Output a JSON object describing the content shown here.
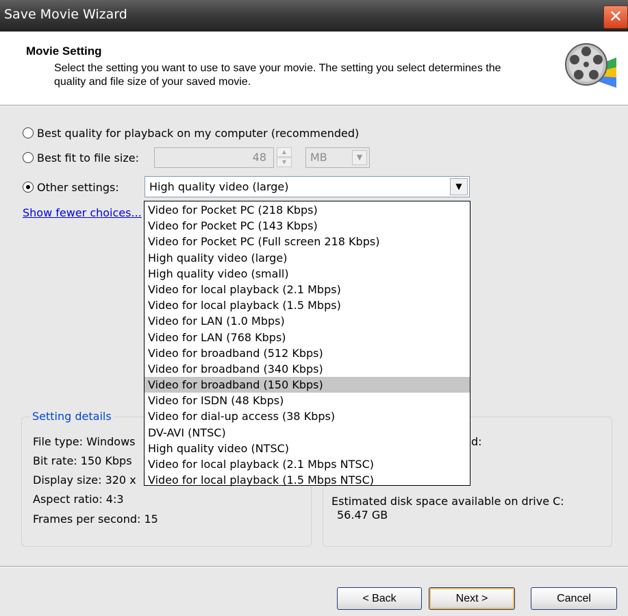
{
  "window": {
    "title": "Save Movie Wizard",
    "close_symbol": "✕",
    "icon": "film-reel-icon"
  },
  "header": {
    "title": "Movie Setting",
    "description": "Select the setting you want to use to save your movie. The setting you select determines the quality and file size of your saved movie."
  },
  "options": {
    "best_quality_label": "Best quality for playback on my computer (recommended)",
    "best_fit_label": "Best fit to file size:",
    "best_fit_value": "48",
    "best_fit_unit": "MB",
    "other_settings_label": "Other settings:",
    "selected_setting": "High quality video (large)",
    "selected_option": "other_settings"
  },
  "show_fewer_link": "Show fewer choices...",
  "dropdown": {
    "items": [
      "Video for Pocket PC (218 Kbps)",
      "Video for Pocket PC (143 Kbps)",
      "Video for Pocket PC (Full screen 218 Kbps)",
      "High quality video (large)",
      "High quality video (small)",
      "Video for local playback (2.1 Mbps)",
      "Video for local playback (1.5 Mbps)",
      "Video for LAN (1.0 Mbps)",
      "Video for LAN (768 Kbps)",
      "Video for broadband (512 Kbps)",
      "Video for broadband (340 Kbps)",
      "Video for broadband (150 Kbps)",
      "Video for ISDN (48 Kbps)",
      "Video for dial-up access (38 Kbps)",
      "DV-AVI (NTSC)",
      "High quality video (NTSC)",
      "Video for local playback (2.1 Mbps NTSC)",
      "Video for local playback (1.5 Mbps NTSC)"
    ],
    "highlighted_item": "Video for broadband (150 Kbps)"
  },
  "setting_details": {
    "legend": "Setting details",
    "file_type": "File type: Windows",
    "bit_rate": "Bit rate: 150 Kbps",
    "display_size": "Display size: 320 x",
    "aspect_ratio": "Aspect ratio: 4:3",
    "fps": "Frames per second: 15"
  },
  "disk": {
    "partial_label": "d:",
    "estimated_label": "Estimated disk space available on drive C:",
    "estimated_value": "56.47 GB"
  },
  "buttons": {
    "back": "< Back",
    "next": "Next >",
    "cancel": "Cancel"
  },
  "colors": {
    "titlebar": "#3d3d3d",
    "close_button": "#d9411c",
    "link": "#0000ee",
    "legend": "#0046d5",
    "body_bg": "#e8e8e8",
    "highlight": "#c6c6c6"
  }
}
